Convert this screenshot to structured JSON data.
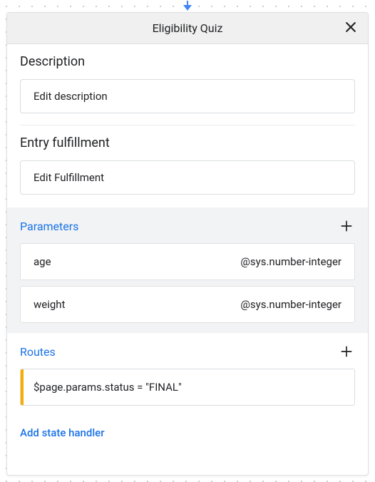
{
  "header": {
    "title": "Eligibility Quiz"
  },
  "sections": {
    "description": {
      "label": "Description",
      "field_text": "Edit description"
    },
    "entry_fulfillment": {
      "label": "Entry fulfillment",
      "field_text": "Edit Fulfillment"
    }
  },
  "parameters": {
    "title": "Parameters",
    "items": [
      {
        "name": "age",
        "type": "@sys.number-integer"
      },
      {
        "name": "weight",
        "type": "@sys.number-integer"
      }
    ]
  },
  "routes": {
    "title": "Routes",
    "items": [
      {
        "expression": "$page.params.status = \"FINAL\""
      }
    ]
  },
  "actions": {
    "add_state_handler": "Add state handler"
  }
}
